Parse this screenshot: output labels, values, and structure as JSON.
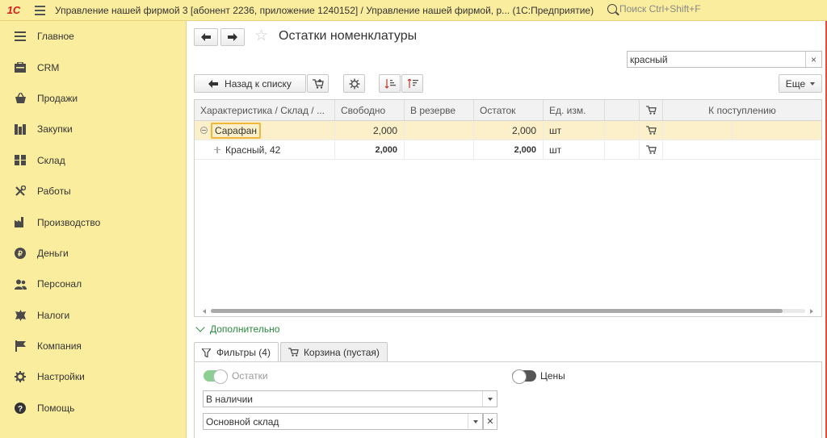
{
  "app": {
    "logo": "1С",
    "title": "Управление нашей фирмой 3 [абонент 2236, приложение 1240152] / Управление нашей фирмой, р...   (1С:Предприятие)",
    "search_placeholder": "Поиск Ctrl+Shift+F"
  },
  "sidebar": {
    "items": [
      {
        "label": "Главное",
        "icon": "menu-icon"
      },
      {
        "label": "CRM",
        "icon": "crm-icon"
      },
      {
        "label": "Продажи",
        "icon": "basket-icon"
      },
      {
        "label": "Закупки",
        "icon": "purchases-icon"
      },
      {
        "label": "Склад",
        "icon": "warehouse-icon"
      },
      {
        "label": "Работы",
        "icon": "tools-icon"
      },
      {
        "label": "Производство",
        "icon": "factory-icon"
      },
      {
        "label": "Деньги",
        "icon": "ruble-icon"
      },
      {
        "label": "Персонал",
        "icon": "people-icon"
      },
      {
        "label": "Налоги",
        "icon": "emblem-icon"
      },
      {
        "label": "Компания",
        "icon": "flag-icon"
      },
      {
        "label": "Настройки",
        "icon": "gear-icon"
      },
      {
        "label": "Помощь",
        "icon": "help-icon"
      }
    ]
  },
  "page": {
    "title": "Остатки номенклатуры",
    "search_value": "красный",
    "back_button": "Назад к списку",
    "more_button": "Еще"
  },
  "grid": {
    "columns": [
      "Характеристика / Склад / ...",
      "Свободно",
      "В резерве",
      "Остаток",
      "Ед. изм.",
      "",
      "",
      "К поступлению"
    ],
    "rows": [
      {
        "name": "Сарафан",
        "free": "2,000",
        "reserve": "",
        "balance": "2,000",
        "unit": "шт",
        "level": 0,
        "selected": true
      },
      {
        "name": "Красный, 42",
        "free": "2,000",
        "reserve": "",
        "balance": "2,000",
        "unit": "шт",
        "level": 1,
        "selected": false
      }
    ]
  },
  "extra": {
    "link": "Дополнительно",
    "tabs": [
      "Фильтры (4)",
      "Корзина (пустая)"
    ],
    "toggle_stock": "Остатки",
    "toggle_prices": "Цены",
    "select_availability": "В наличии",
    "select_warehouse": "Основной склад"
  },
  "colors": {
    "sidebar_bg": "#fbed9e",
    "accent_green": "#2b8a3e",
    "selected_row": "#fbf0c9"
  }
}
